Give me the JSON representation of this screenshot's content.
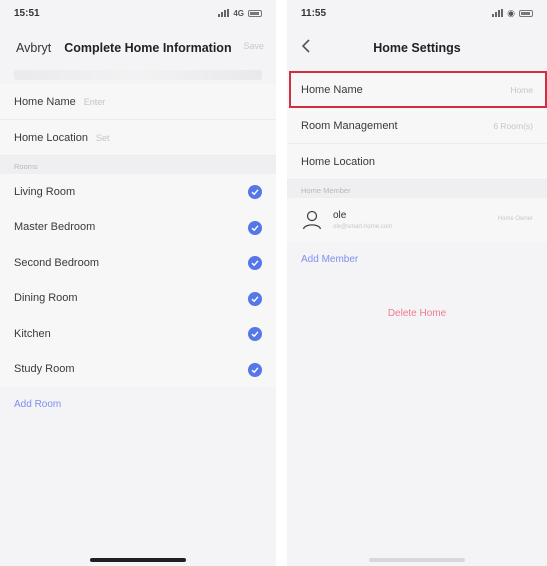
{
  "left_screen": {
    "status_time": "15:51",
    "status_network": "4G",
    "nav": {
      "cancel_label": "Avbryt",
      "title": "Complete Home Information",
      "right_label": "Save"
    },
    "fields": [
      {
        "label": "Home Name",
        "placeholder": "Enter"
      },
      {
        "label": "Home Location",
        "placeholder": "Set"
      }
    ],
    "rooms_section_label": "Rooms",
    "rooms": [
      "Living Room",
      "Master Bedroom",
      "Second Bedroom",
      "Dining Room",
      "Kitchen",
      "Study Room"
    ],
    "add_room_label": "Add Room"
  },
  "right_screen": {
    "status_time": "11:55",
    "nav": {
      "title": "Home Settings"
    },
    "rows": [
      {
        "label": "Home Name",
        "value": "Home"
      },
      {
        "label": "Room Management",
        "value": "6 Room(s)"
      },
      {
        "label": "Home Location",
        "value": ""
      }
    ],
    "member_section_label": "Home Member",
    "member": {
      "name": "ole",
      "email": "ole@smart-home.com",
      "role": "Home Owner"
    },
    "add_member_label": "Add Member",
    "delete_home_label": "Delete Home"
  },
  "colors": {
    "accent": "#5677e8",
    "link": "#7f8ef0",
    "danger": "#f07b8f",
    "highlight": "#d12e42"
  }
}
